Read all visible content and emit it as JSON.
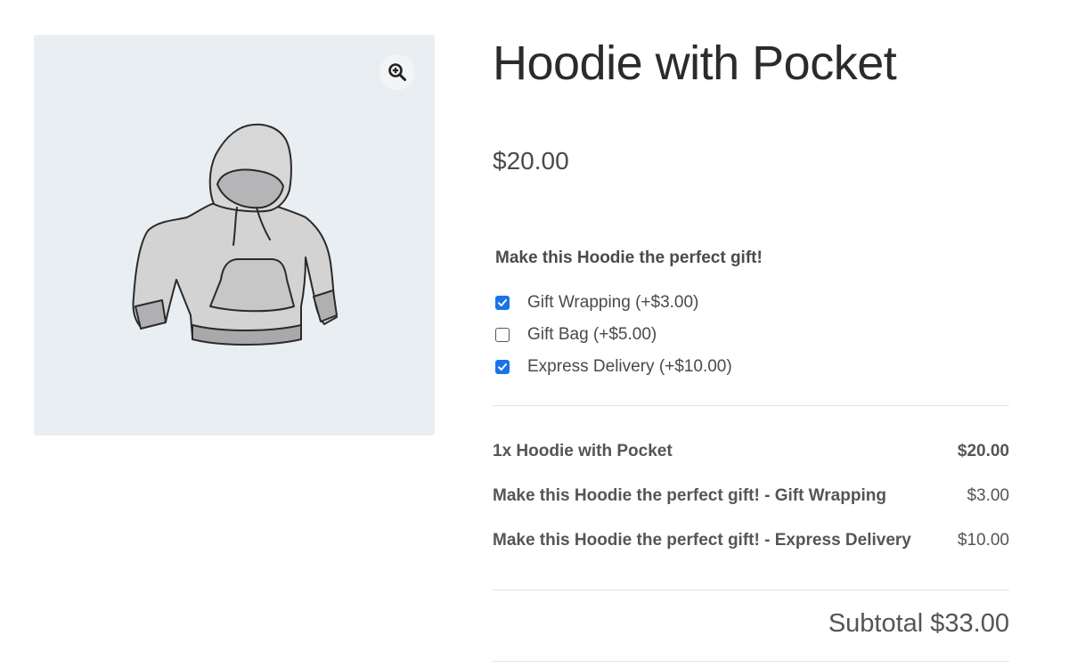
{
  "product": {
    "title": "Hoodie with Pocket",
    "price": "$20.00",
    "image_alt": "hoodie-illustration"
  },
  "gallery": {
    "zoom_icon": "zoom-in-icon",
    "background": "#e9eef3"
  },
  "addons": {
    "heading": "Make this Hoodie the perfect gift!",
    "options": [
      {
        "label": "Gift Wrapping (+$3.00)",
        "checked": true
      },
      {
        "label": "Gift Bag (+$5.00)",
        "checked": false
      },
      {
        "label": "Express Delivery (+$10.00)",
        "checked": true
      }
    ]
  },
  "totals": {
    "items": [
      {
        "name": "1x Hoodie with Pocket",
        "amount": "$20.00",
        "bold_amount": true
      },
      {
        "name": "Make this Hoodie the perfect gift! - Gift Wrapping",
        "amount": "$3.00",
        "bold_amount": false
      },
      {
        "name": "Make this Hoodie the perfect gift! - Express Delivery",
        "amount": "$10.00",
        "bold_amount": false
      }
    ],
    "subtotal": "Subtotal $33.00"
  },
  "colors": {
    "checkbox_accent": "#1a73e8",
    "text": "#4a4a4a"
  }
}
